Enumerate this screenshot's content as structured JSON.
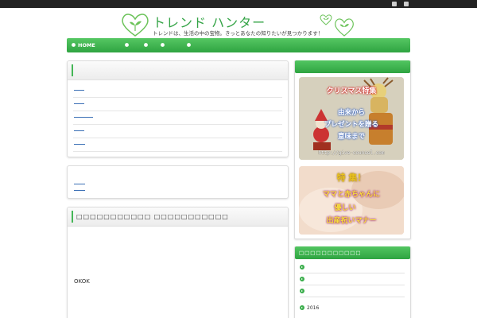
{
  "header": {
    "site_title": "トレンド ハンター",
    "tagline": "トレンドは、生活の中の宝物。きっとあなたの知りたいが見つかります！"
  },
  "nav": {
    "home_label": "HOME",
    "items": [
      "",
      "",
      "",
      "",
      ""
    ]
  },
  "main": {
    "post_list_title": "",
    "post_list_links": [
      "",
      "",
      "",
      "",
      ""
    ],
    "pager_links": [
      "",
      ""
    ],
    "section_title": "□□□□□□□□□□□ □□□□□□□□□□□",
    "body_text": "OKOK"
  },
  "sidebar": {
    "top_widget_title": "",
    "banner1": {
      "line1": "クリスマス特集",
      "line2": "由来から",
      "line3": "プレゼントを贈る",
      "line4": "意味まで",
      "url": "http://give-counsel.com"
    },
    "banner2": {
      "line1": "特  集！",
      "line2": "ママと赤ちゃんに",
      "line3": "優しい",
      "line4": "出産祝いマナー"
    },
    "archive_title": "□□□□□□□□□□□",
    "archive_items": [
      "",
      "",
      "",
      "2016",
      ""
    ]
  },
  "colors": {
    "brand_green": "#35a447",
    "nav_green": "#2fa441",
    "link_blue": "#3a6fb5",
    "topbar": "#222222"
  }
}
